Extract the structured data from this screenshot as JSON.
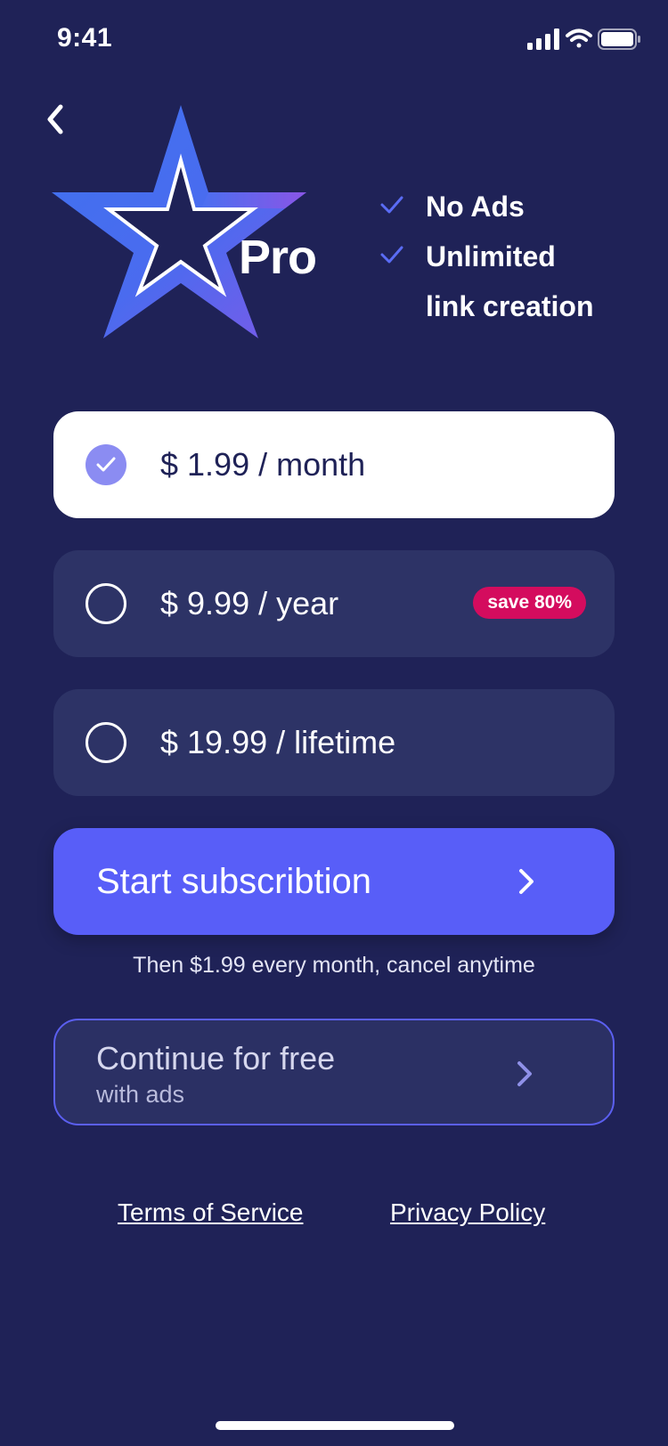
{
  "status_bar": {
    "time": "9:41"
  },
  "hero": {
    "product_label": "Pro"
  },
  "features": [
    {
      "text": "No Ads"
    },
    {
      "text": "Unlimited"
    },
    {
      "text": "link creation"
    }
  ],
  "plans": [
    {
      "price": "$ 1.99 / month",
      "selected": true
    },
    {
      "price": "$ 9.99 / year",
      "selected": false,
      "badge": "save 80%"
    },
    {
      "price": "$ 19.99 / lifetime",
      "selected": false
    }
  ],
  "cta": {
    "label": "Start subscribtion",
    "note": "Then $1.99 every month, cancel anytime"
  },
  "free_option": {
    "title": "Continue for free",
    "subtitle": "with ads"
  },
  "footer": {
    "terms": "Terms of Service",
    "privacy": "Privacy Policy"
  },
  "colors": {
    "background": "#1f2257",
    "plan_bg": "#2d3366",
    "accent": "#585ef8",
    "badge": "#d40c5e",
    "check": "#5a6cf5"
  },
  "icons": {
    "back": "chevron-left-icon",
    "check": "checkmark-icon",
    "cta": "chevron-right-icon"
  }
}
